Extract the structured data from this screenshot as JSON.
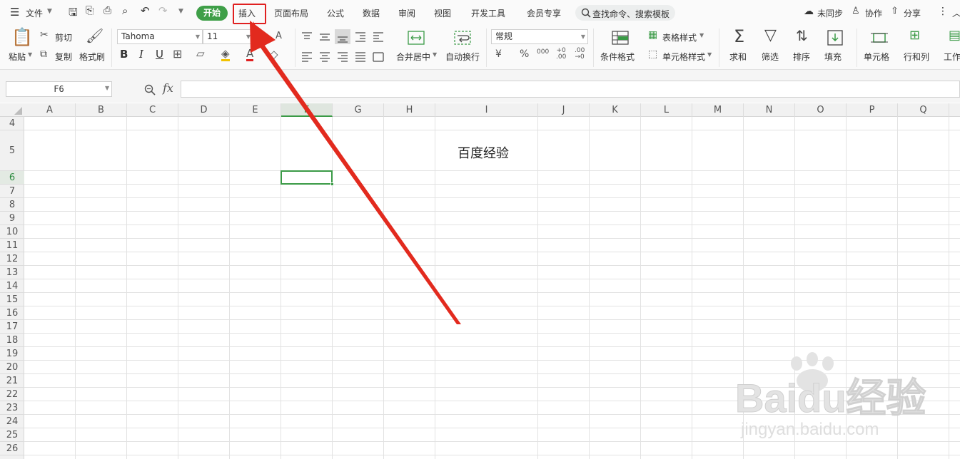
{
  "menubar": {
    "file_label": "文件",
    "tabs": [
      "开始",
      "插入",
      "页面布局",
      "公式",
      "数据",
      "审阅",
      "视图",
      "开发工具",
      "会员专享"
    ],
    "active_tab": "开始",
    "search_label": "查找命令、搜索模板",
    "sync_label": "未同步",
    "collab_label": "协作",
    "share_label": "分享"
  },
  "ribbon": {
    "paste": "粘贴",
    "cut": "剪切",
    "copy": "复制",
    "format_painter": "格式刷",
    "font_name": "Tahoma",
    "font_size": "11",
    "merge_center": "合并居中",
    "wrap_text": "自动换行",
    "number_format": "常规",
    "table_style": "表格样式",
    "conditional_format": "条件格式",
    "cell_style": "单元格样式",
    "sum": "求和",
    "filter": "筛选",
    "sort": "排序",
    "fill": "填充",
    "cell": "单元格",
    "row_col": "行和列",
    "worksheet": "工作"
  },
  "formula_bar": {
    "name_box": "F6",
    "fx": "fx",
    "value": ""
  },
  "grid": {
    "columns": [
      "A",
      "B",
      "C",
      "D",
      "E",
      "F",
      "G",
      "H",
      "I",
      "J",
      "K",
      "L",
      "M",
      "N",
      "O",
      "P",
      "Q"
    ],
    "rows": [
      "4",
      "5",
      "6",
      "7",
      "8",
      "9",
      "10",
      "11",
      "12",
      "13",
      "14",
      "15",
      "16",
      "17",
      "18",
      "19",
      "20",
      "21",
      "22",
      "23",
      "24",
      "25",
      "26"
    ],
    "selected_column": "F",
    "selected_row": "6",
    "cell_I5": "百度经验"
  },
  "watermark": {
    "brand": "Baidu经验",
    "url": "jingyan.baidu.com"
  },
  "colors": {
    "accent_green": "#3f9f48",
    "annotation_red": "#e02020"
  }
}
